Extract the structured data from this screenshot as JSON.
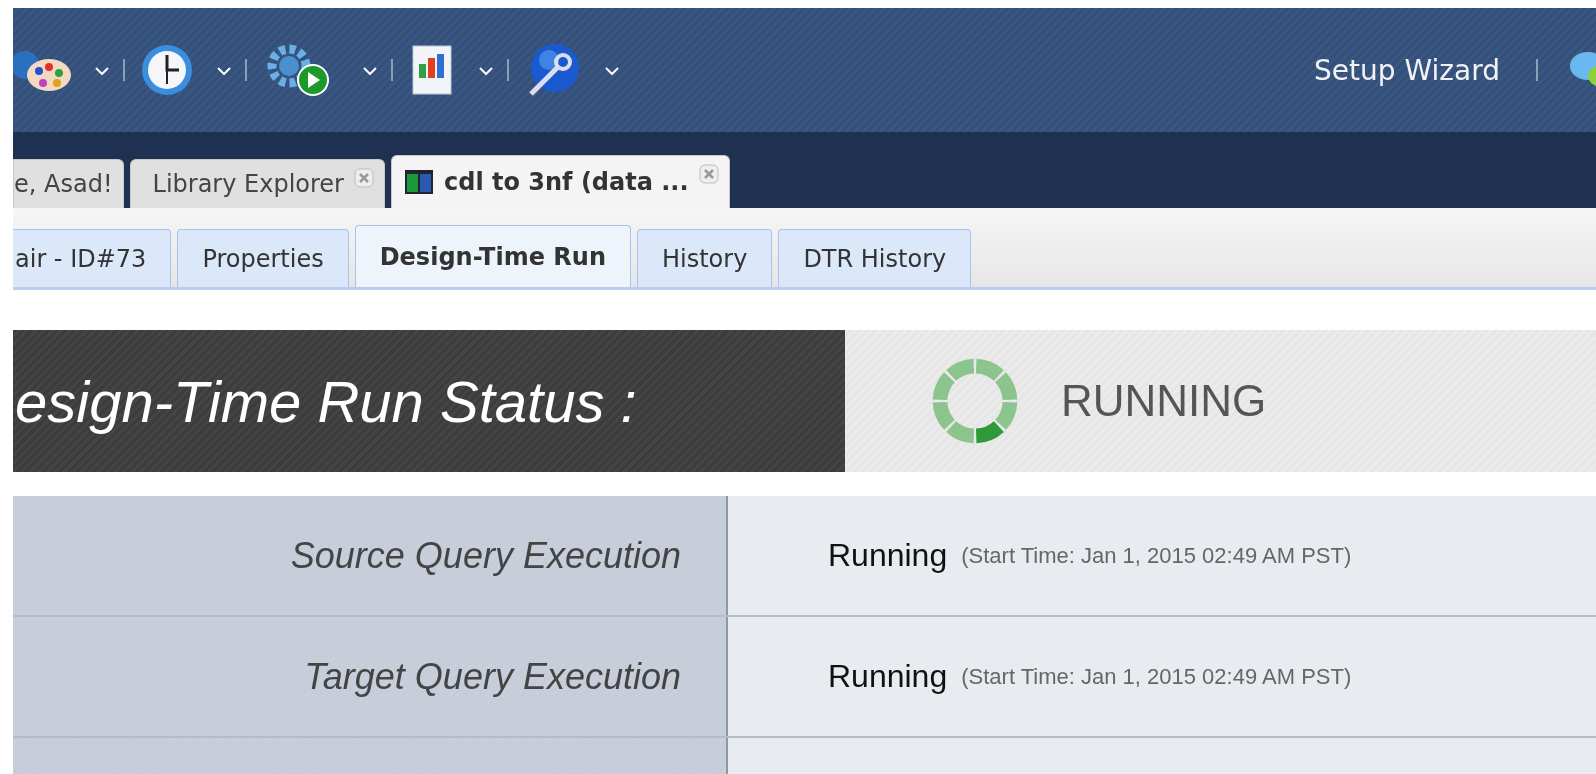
{
  "toolbar": {
    "items": [
      {
        "kind": "palette"
      },
      {
        "kind": "clock"
      },
      {
        "kind": "gear-play"
      },
      {
        "kind": "chart"
      },
      {
        "kind": "globe-wrench"
      }
    ],
    "links": [
      "Setup Wizard"
    ]
  },
  "tabs": [
    {
      "label": "e, Asad!",
      "selected": false,
      "closable": false,
      "icon": false
    },
    {
      "label": "Library Explorer",
      "selected": false,
      "closable": true,
      "icon": false
    },
    {
      "label": "cdl to 3nf (data ...",
      "selected": true,
      "closable": true,
      "icon": true
    }
  ],
  "subtabs": [
    {
      "label": "air - ID#73",
      "selected": false
    },
    {
      "label": "Properties",
      "selected": false
    },
    {
      "label": "Design-Time Run",
      "selected": true
    },
    {
      "label": "History",
      "selected": false
    },
    {
      "label": "DTR History",
      "selected": false
    }
  ],
  "status": {
    "title": "esign-Time Run Status :",
    "value": "RUNNING"
  },
  "rows": [
    {
      "label": "Source Query Execution",
      "status": "Running",
      "detail": "(Start Time: Jan 1, 2015 02:49 AM PST)"
    },
    {
      "label": "Target Query Execution",
      "status": "Running",
      "detail": "(Start Time: Jan 1, 2015 02:49 AM PST)"
    },
    {
      "label": "",
      "status": "",
      "detail": ""
    }
  ]
}
